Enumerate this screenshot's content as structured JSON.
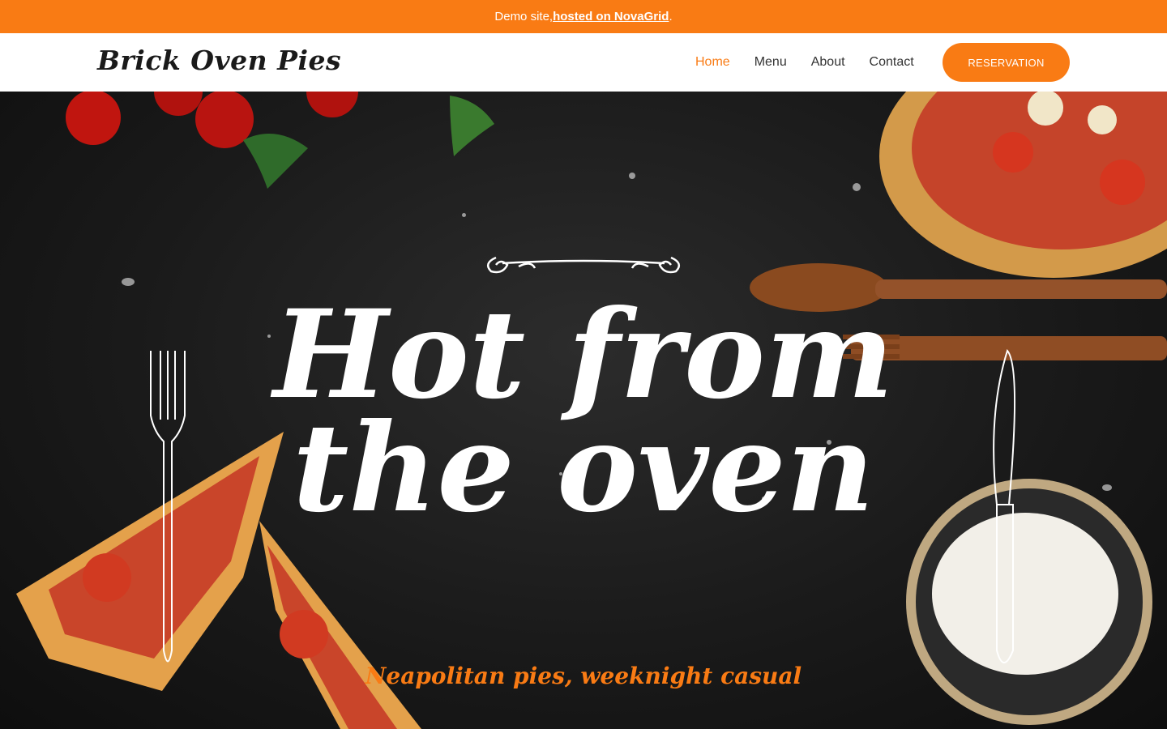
{
  "notice": {
    "prefix": "Demo site, ",
    "link": "hosted on NovaGrid",
    "suffix": "."
  },
  "header": {
    "logo": "Brick Oven Pies",
    "nav": [
      "Home",
      "Menu",
      "About",
      "Contact"
    ],
    "active_nav": "Home",
    "reservation_label": "RESERVATION"
  },
  "hero": {
    "title": "Hot from the oven",
    "subtitle": "Neapolitan pies, weeknight casual"
  },
  "colors": {
    "accent": "#f97b14",
    "hero_bg": "#1a1a1a",
    "text_dark": "#1a1a1a"
  },
  "icons": [
    "flourish-divider-icon",
    "fork-icon",
    "knife-icon"
  ]
}
